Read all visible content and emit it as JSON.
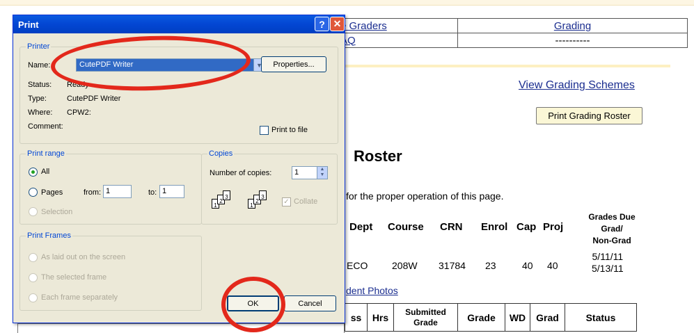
{
  "background": {
    "nav": {
      "row1_col1": "e Graders",
      "row1_col2": "Grading",
      "row2_col1": "AQ",
      "row2_col2": "----------"
    },
    "view_grading_schemes": "View Grading Schemes",
    "print_grading_roster": "Print Grading Roster",
    "roster_title": "Roster",
    "proper_operation": "for the proper operation of this page.",
    "headers": {
      "dept": "Dept",
      "course": "Course",
      "crn": "CRN",
      "enrol": "Enrol",
      "cap": "Cap",
      "proj": "Proj",
      "grades_due": "Grades Due",
      "grad": "Grad/",
      "non_grad": "Non-Grad"
    },
    "row": {
      "dept": "ECO",
      "course": "208W",
      "crn": "31784",
      "enrol": "23",
      "cap": "40",
      "proj": "40",
      "due_grad": "5/11/11",
      "due_non_grad": "5/13/11"
    },
    "student_photos": "dent Photos",
    "sub_headers": {
      "ss": "ss",
      "hrs": "Hrs",
      "submitted": "Submitted",
      "grade_sub": "Grade",
      "grade": "Grade",
      "wd": "WD",
      "grad": "Grad",
      "status": "Status"
    }
  },
  "dialog": {
    "title": "Print",
    "help_glyph": "?",
    "close_glyph": "✕",
    "printer": {
      "group_label": "Printer",
      "name_label": "Name:",
      "name_value": "CutePDF Writer",
      "properties_button": "Properties...",
      "status_label": "Status:",
      "status_value": "Ready",
      "type_label": "Type:",
      "type_value": "CutePDF Writer",
      "where_label": "Where:",
      "where_value": "CPW2:",
      "comment_label": "Comment:",
      "print_to_file": "Print to file"
    },
    "print_range": {
      "group_label": "Print range",
      "all": "All",
      "pages": "Pages",
      "from_label": "from:",
      "from_value": "1",
      "to_label": "to:",
      "to_value": "1",
      "selection": "Selection"
    },
    "copies": {
      "group_label": "Copies",
      "number_label": "Number of copies:",
      "number_value": "1",
      "collate": "Collate",
      "page_nums": [
        "1",
        "2",
        "3"
      ]
    },
    "print_frames": {
      "group_label": "Print Frames",
      "option1": "As laid out on the screen",
      "option2": "The selected frame",
      "option3": "Each frame separately"
    },
    "ok_button": "OK",
    "cancel_button": "Cancel"
  },
  "annotation_color": "#e3281b"
}
